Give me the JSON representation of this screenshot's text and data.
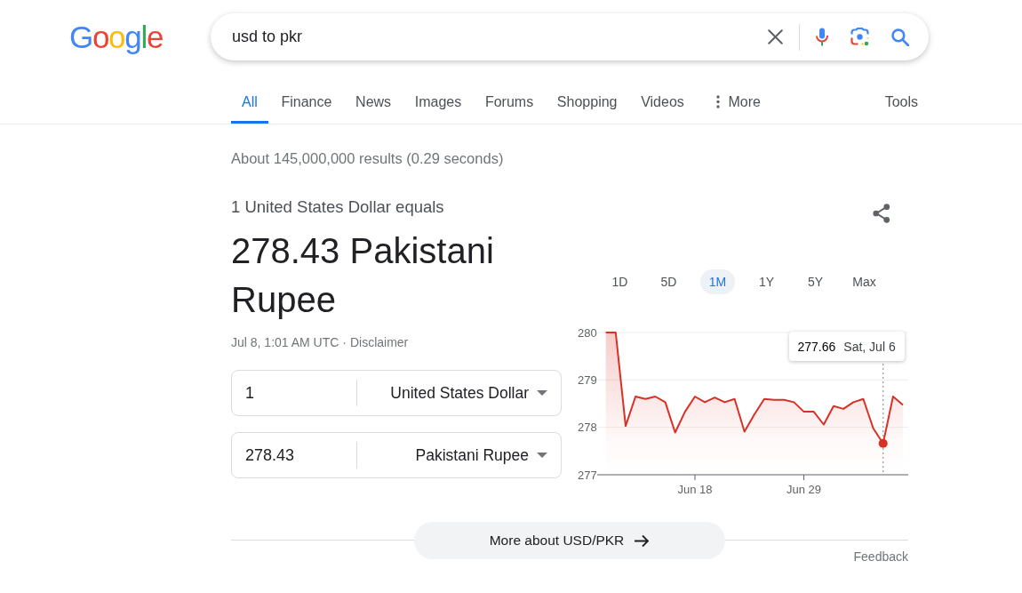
{
  "logo": {
    "text": "Google"
  },
  "search": {
    "query": "usd to pkr"
  },
  "tabs": [
    {
      "label": "All",
      "selected": true,
      "kind": "link"
    },
    {
      "label": "Finance",
      "selected": false,
      "kind": "link"
    },
    {
      "label": "News",
      "selected": false,
      "kind": "link"
    },
    {
      "label": "Images",
      "selected": false,
      "kind": "link"
    },
    {
      "label": "Forums",
      "selected": false,
      "kind": "link"
    },
    {
      "label": "Shopping",
      "selected": false,
      "kind": "link"
    },
    {
      "label": "Videos",
      "selected": false,
      "kind": "link"
    },
    {
      "label": "More",
      "selected": false,
      "kind": "menu"
    }
  ],
  "tools": "Tools",
  "result_stats": "About 145,000,000 results (0.29 seconds)",
  "currency": {
    "heading": "1 United States Dollar equals",
    "result": "278.43 Pakistani Rupee",
    "timestamp": "Jul 8, 1:01 AM UTC ·",
    "disclaimer": "Disclaimer",
    "rows": [
      {
        "amount": "1",
        "currency": "United States Dollar"
      },
      {
        "amount": "278.43",
        "currency": "Pakistani Rupee"
      }
    ]
  },
  "chart": {
    "ranges": [
      {
        "label": "1D",
        "selected": false
      },
      {
        "label": "5D",
        "selected": false
      },
      {
        "label": "1M",
        "selected": true
      },
      {
        "label": "1Y",
        "selected": false
      },
      {
        "label": "5Y",
        "selected": false
      },
      {
        "label": "Max",
        "selected": false
      }
    ],
    "chart_data": {
      "type": "area",
      "categories": [
        null,
        null,
        null,
        null,
        null,
        null,
        null,
        null,
        null,
        "Jun 18",
        null,
        null,
        null,
        null,
        null,
        null,
        null,
        null,
        null,
        null,
        "Jun 29",
        null,
        null,
        null,
        null,
        null,
        null,
        null,
        null,
        null,
        null
      ],
      "series": [
        {
          "color": "#d93025",
          "values": [
            280.0,
            280.0,
            278.03,
            278.65,
            278.6,
            278.65,
            278.53,
            277.89,
            278.33,
            278.65,
            278.53,
            278.63,
            278.53,
            278.6,
            277.91,
            278.27,
            278.6,
            278.58,
            278.58,
            278.53,
            278.33,
            278.33,
            278.06,
            278.45,
            278.39,
            278.53,
            278.6,
            277.98,
            277.66,
            278.65,
            278.47
          ]
        }
      ],
      "ylim": [
        277,
        280
      ],
      "yticks": [
        277,
        278,
        279,
        280
      ]
    },
    "tooltip": {
      "value": "277.66",
      "date": "Sat, Jul 6"
    }
  },
  "more_button": "More about USD/PKR",
  "feedback": "Feedback"
}
